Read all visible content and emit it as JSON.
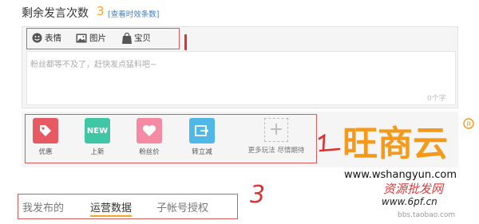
{
  "header": {
    "title": "剩余发言次数",
    "count": "3",
    "stats_link": "[查看时效条数]"
  },
  "toolbar": {
    "items": [
      {
        "label": "表情",
        "icon": "smile-icon"
      },
      {
        "label": "图片",
        "icon": "image-icon"
      },
      {
        "label": "宝贝",
        "icon": "bag-icon"
      }
    ]
  },
  "composer": {
    "placeholder": "粉丝都等不及了，赶快发点猛料吧~",
    "char_count": "0个字"
  },
  "plugins": {
    "items": [
      {
        "label": "优惠",
        "icon": "tag-icon",
        "color": "#e55a63"
      },
      {
        "label": "上新",
        "icon": "new-icon",
        "color": "#3fc6a5"
      },
      {
        "label": "粉丝价",
        "icon": "heart-price-icon",
        "color": "#f48aa3"
      },
      {
        "label": "转立减",
        "icon": "share-discount-icon",
        "color": "#4fb8e6"
      }
    ],
    "more_label": "更多玩法 尽情期待"
  },
  "tabs": [
    {
      "label": "我发布的",
      "active": false
    },
    {
      "label": "运营数据",
      "active": true
    },
    {
      "label": "子帐号授权",
      "active": false
    }
  ],
  "branding": {
    "logo_text": "旺商云",
    "site": "www.wshangyun.com",
    "stamp": "资源批发网",
    "stamp_url": "www.6pf.cn",
    "watermark": "bbs.taobao.com"
  },
  "annotations": {
    "mark_3": "3"
  },
  "colors": {
    "accent": "#f5a623",
    "link": "#3f7fc7",
    "annotation": "#d85a5a",
    "logo_orange": "#f39a1b"
  }
}
